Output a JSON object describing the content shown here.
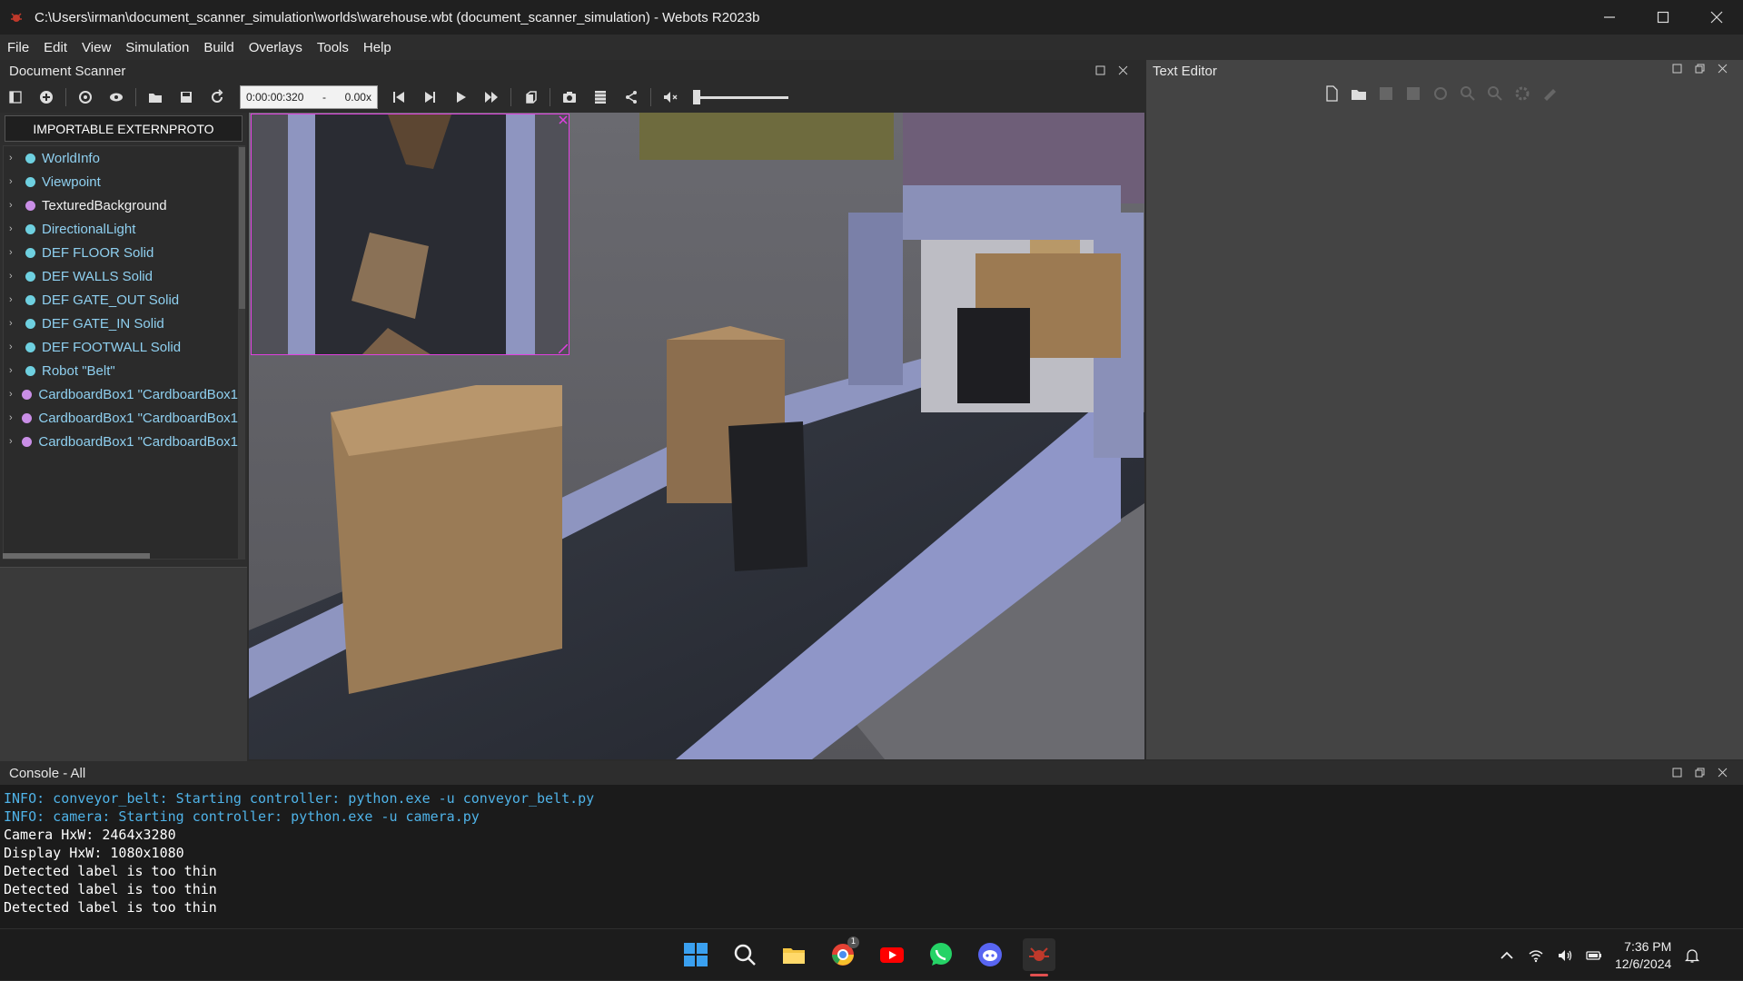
{
  "window": {
    "title": "C:\\Users\\irman\\document_scanner_simulation\\worlds\\warehouse.wbt (document_scanner_simulation) - Webots R2023b"
  },
  "menu": [
    "File",
    "Edit",
    "View",
    "Simulation",
    "Build",
    "Overlays",
    "Tools",
    "Help"
  ],
  "left_panel": {
    "title": "Document Scanner",
    "proto_button": "IMPORTABLE EXTERNPROTO",
    "tree": [
      {
        "label": "WorldInfo",
        "color": "#6ed0e0"
      },
      {
        "label": "Viewpoint",
        "color": "#6ed0e0"
      },
      {
        "label": "TexturedBackground",
        "color": "#c98ee6"
      },
      {
        "label": "DirectionalLight",
        "color": "#6ed0e0"
      },
      {
        "label": "DEF FLOOR Solid",
        "color": "#6ed0e0"
      },
      {
        "label": "DEF WALLS Solid",
        "color": "#6ed0e0"
      },
      {
        "label": "DEF GATE_OUT Solid",
        "color": "#6ed0e0"
      },
      {
        "label": "DEF GATE_IN Solid",
        "color": "#6ed0e0"
      },
      {
        "label": "DEF FOOTWALL Solid",
        "color": "#6ed0e0"
      },
      {
        "label": "Robot \"Belt\"",
        "color": "#6ed0e0"
      },
      {
        "label": "CardboardBox1 \"CardboardBox1",
        "color": "#c98ee6"
      },
      {
        "label": "CardboardBox1 \"CardboardBox1",
        "color": "#c98ee6"
      },
      {
        "label": "CardboardBox1 \"CardboardBox1",
        "color": "#c98ee6"
      }
    ]
  },
  "toolbar": {
    "time": "0:00:00:320",
    "separator": "-",
    "speed": "0.00x",
    "volume_level": 0.0
  },
  "text_editor": {
    "title": "Text Editor"
  },
  "console": {
    "title": "Console - All",
    "lines": [
      {
        "text": "INFO: conveyor_belt: Starting controller: python.exe -u conveyor_belt.py",
        "color": "#4fb3e8"
      },
      {
        "text": "INFO: camera: Starting controller: python.exe -u camera.py",
        "color": "#4fb3e8"
      },
      {
        "text": "Camera HxW: 2464x3280",
        "color": "#ffffff"
      },
      {
        "text": "Display HxW: 1080x1080",
        "color": "#ffffff"
      },
      {
        "text": "Detected label is too thin",
        "color": "#ffffff"
      },
      {
        "text": "Detected label is too thin",
        "color": "#ffffff"
      },
      {
        "text": "Detected label is too thin",
        "color": "#ffffff"
      }
    ]
  },
  "taskbar": {
    "apps": [
      "windows-start-icon",
      "search-icon",
      "file-explorer-icon",
      "chrome-icon",
      "youtube-icon",
      "whatsapp-icon",
      "discord-icon",
      "webots-icon"
    ],
    "chrome_badge": "1",
    "time": "7:36 PM",
    "date": "12/6/2024"
  },
  "colors": {
    "accent_magenta": "#e040e0",
    "info_blue": "#4fb3e8"
  }
}
